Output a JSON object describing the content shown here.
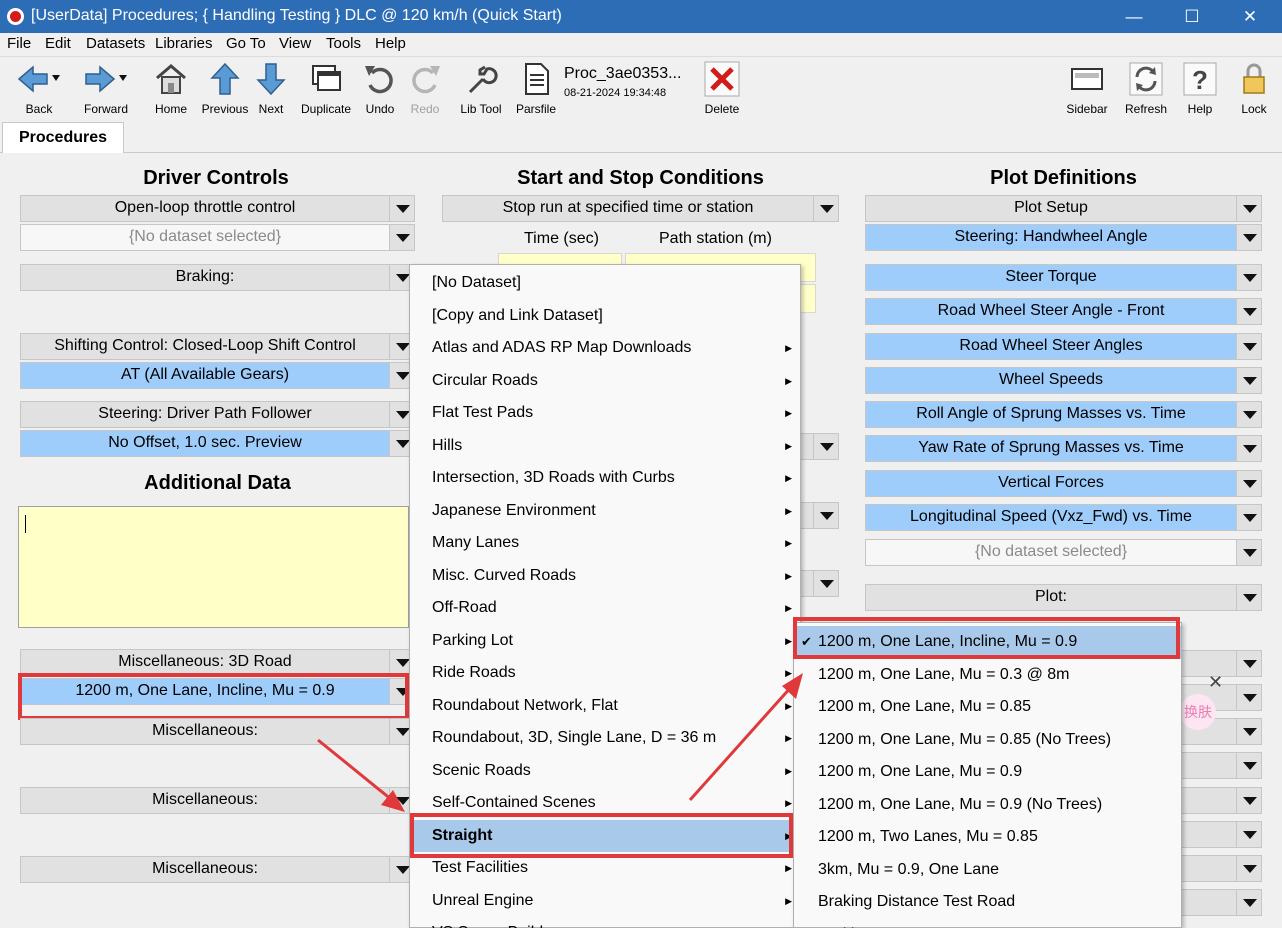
{
  "window": {
    "title": "[UserData] Procedures; { Handling Testing } DLC @ 120 km/h (Quick Start)",
    "minimize": "—",
    "maximize": "☐",
    "close": "✕"
  },
  "menubar": [
    "File",
    "Edit",
    "Datasets",
    "Libraries",
    "Go To",
    "View",
    "Tools",
    "Help"
  ],
  "toolbar": {
    "back": "Back",
    "forward": "Forward",
    "home": "Home",
    "previous": "Previous",
    "next": "Next",
    "duplicate": "Duplicate",
    "undo": "Undo",
    "redo": "Redo",
    "lib_tool": "Lib Tool",
    "parsfile": "Parsfile",
    "parsfile_name": "Proc_3ae0353...",
    "parsfile_date": "08-21-2024 19:34:48",
    "delete": "Delete",
    "sidebar": "Sidebar",
    "refresh": "Refresh",
    "help": "Help",
    "lock": "Lock"
  },
  "tabs": {
    "active": "Procedures"
  },
  "driver_controls": {
    "heading": "Driver Controls",
    "throttle": "Open-loop throttle control",
    "throttle_dataset": "{No dataset selected}",
    "braking": "Braking:",
    "shifting": "Shifting Control: Closed-Loop Shift Control",
    "shifting_dataset": "AT (All Available Gears)",
    "steering": "Steering: Driver Path Follower",
    "steering_dataset": "No Offset, 1.0 sec. Preview"
  },
  "additional_data": {
    "heading": "Additional Data",
    "text": ""
  },
  "misc": {
    "road_label": "Miscellaneous: 3D Road",
    "road_value": "1200 m, One Lane, Incline, Mu = 0.9",
    "misc1": "Miscellaneous:",
    "misc2": "Miscellaneous:",
    "misc3": "Miscellaneous:"
  },
  "start_stop": {
    "heading": "Start and Stop Conditions",
    "stop_run": "Stop run at specified time or station",
    "col_time": "Time (sec)",
    "col_station": "Path station (m)"
  },
  "plot_definitions": {
    "heading": "Plot Definitions",
    "plot_setup": "Plot Setup",
    "items": [
      "Steering: Handwheel Angle",
      "Steer Torque",
      "Road Wheel Steer Angle - Front",
      "Road Wheel Steer Angles",
      "Wheel Speeds",
      "Roll Angle of Sprung Masses vs. Time",
      "Yaw Rate of Sprung Masses vs. Time",
      "Vertical Forces",
      "Longitudinal Speed (Vxz_Fwd) vs. Time"
    ],
    "no_dataset": "{No dataset selected}",
    "plot": "Plot:"
  },
  "category_menu": {
    "items": [
      {
        "label": "[No Dataset]",
        "sub": false
      },
      {
        "label": "[Copy and Link Dataset]",
        "sub": false
      },
      {
        "label": "Atlas and ADAS RP Map Downloads",
        "sub": true
      },
      {
        "label": "Circular Roads",
        "sub": true
      },
      {
        "label": "Flat Test Pads",
        "sub": true
      },
      {
        "label": "Hills",
        "sub": true
      },
      {
        "label": "Intersection, 3D Roads with Curbs",
        "sub": true
      },
      {
        "label": "Japanese Environment",
        "sub": true
      },
      {
        "label": "Many Lanes",
        "sub": true
      },
      {
        "label": "Misc. Curved Roads",
        "sub": true
      },
      {
        "label": "Off-Road",
        "sub": true
      },
      {
        "label": "Parking Lot",
        "sub": true
      },
      {
        "label": "Ride Roads",
        "sub": true
      },
      {
        "label": "Roundabout Network, Flat",
        "sub": true
      },
      {
        "label": "Roundabout, 3D, Single Lane, D = 36 m",
        "sub": true
      },
      {
        "label": "Scenic Roads",
        "sub": true
      },
      {
        "label": "Self-Contained Scenes",
        "sub": true
      },
      {
        "label": "Straight",
        "sub": true,
        "selected": true
      },
      {
        "label": "Test Facilities",
        "sub": true
      },
      {
        "label": "Unreal Engine",
        "sub": true
      },
      {
        "label": "VS Scene Builder",
        "sub": true
      }
    ]
  },
  "straight_submenu": {
    "items": [
      {
        "label": "1200 m, One Lane, Incline, Mu = 0.9",
        "checked": true
      },
      {
        "label": "1200 m, One Lane, Mu = 0.3 @ 8m"
      },
      {
        "label": "1200 m, One Lane, Mu = 0.85"
      },
      {
        "label": "1200 m, One Lane, Mu = 0.85 (No Trees)"
      },
      {
        "label": "1200 m, One Lane, Mu = 0.9"
      },
      {
        "label": "1200 m, One Lane, Mu = 0.9 (No Trees)"
      },
      {
        "label": "1200 m, Two Lanes, Mu = 0.85"
      },
      {
        "label": "3km, Mu = 0.9, One Lane"
      },
      {
        "label": "Braking Distance Test Road"
      },
      {
        "label": "Braking Gutter"
      }
    ]
  },
  "ime_badge": "换肤",
  "colors": {
    "titlebar": "#2d6db5",
    "blue_field": "#9fcdfb",
    "yellow_field": "#ffffc8",
    "highlight": "#e0393b",
    "menu_selected": "#a9c9ea"
  }
}
